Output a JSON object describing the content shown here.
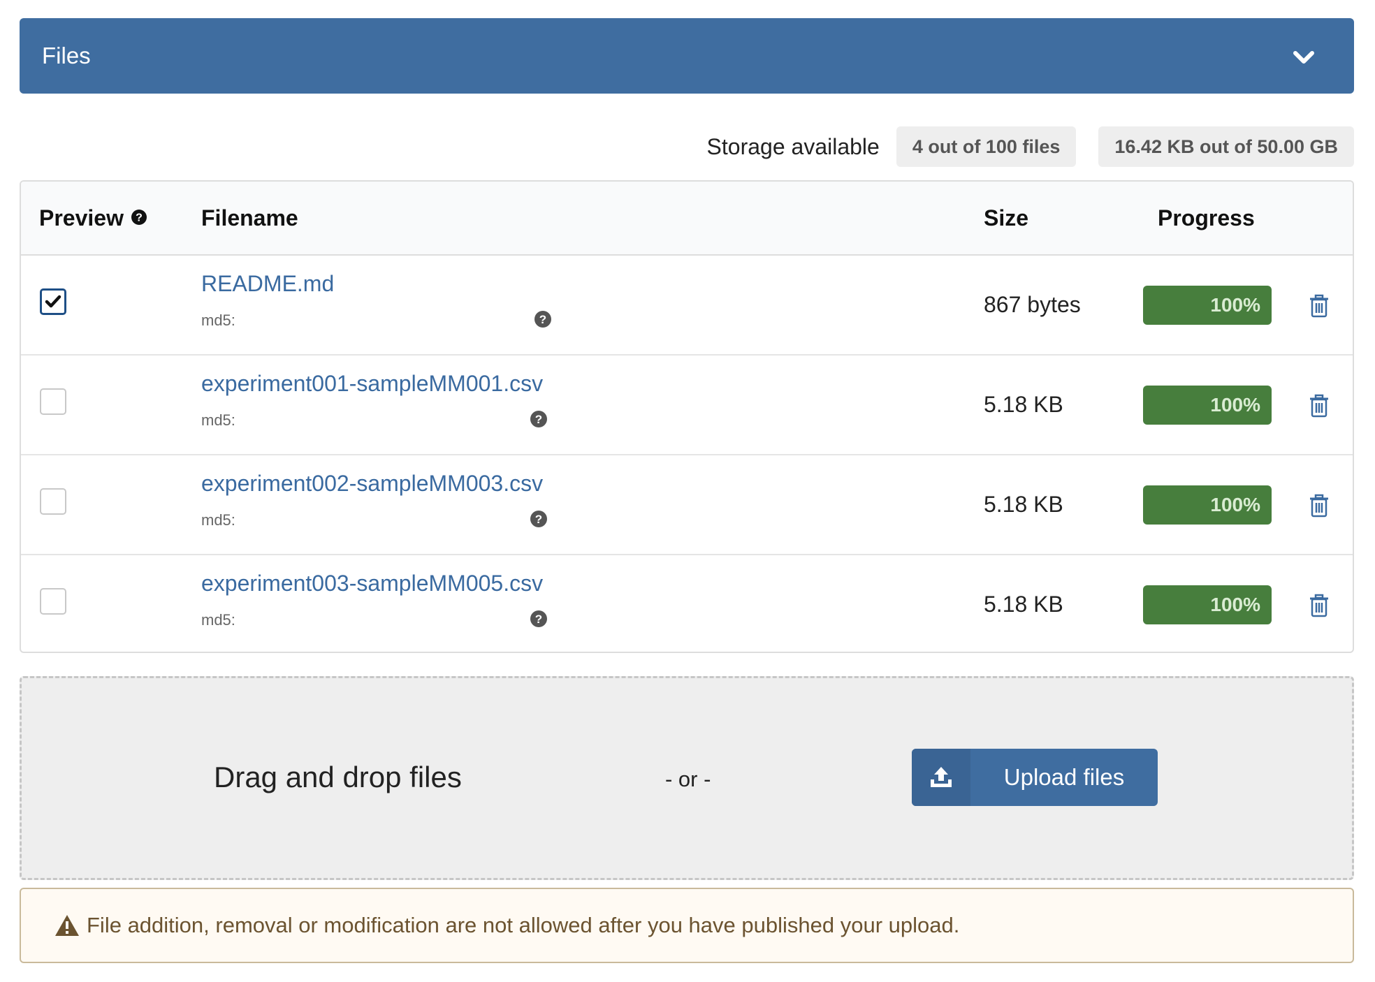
{
  "panel": {
    "title": "Files",
    "toggle_icon": "chevron-down-icon"
  },
  "storage": {
    "label": "Storage available",
    "files_badge": "4 out of 100 files",
    "size_badge": "16.42 KB out of 50.00 GB"
  },
  "table": {
    "headers": {
      "preview": "Preview",
      "filename": "Filename",
      "size": "Size",
      "progress": "Progress"
    },
    "rows": [
      {
        "preview_checked": true,
        "filename": "README.md",
        "md5_label": "md5:",
        "size": "867 bytes",
        "progress": "100%",
        "progress_value": 100
      },
      {
        "preview_checked": false,
        "filename": "experiment001-sampleMM001.csv",
        "md5_label": "md5:",
        "size": "5.18 KB",
        "progress": "100%",
        "progress_value": 100
      },
      {
        "preview_checked": false,
        "filename": "experiment002-sampleMM003.csv",
        "md5_label": "md5:",
        "size": "5.18 KB",
        "progress": "100%",
        "progress_value": 100
      },
      {
        "preview_checked": false,
        "filename": "experiment003-sampleMM005.csv",
        "md5_label": "md5:",
        "size": "5.18 KB",
        "progress": "100%",
        "progress_value": 100
      }
    ]
  },
  "dropzone": {
    "text": "Drag and drop files",
    "or_text": "- or -",
    "upload_label": "Upload files"
  },
  "warning": {
    "text": "File addition, removal or modification are not allowed after you have published your upload."
  },
  "colors": {
    "header_blue": "#3f6da0",
    "progress_green": "#477e3d",
    "link_blue": "#3a6aa0",
    "warning_text": "#6b5330"
  }
}
